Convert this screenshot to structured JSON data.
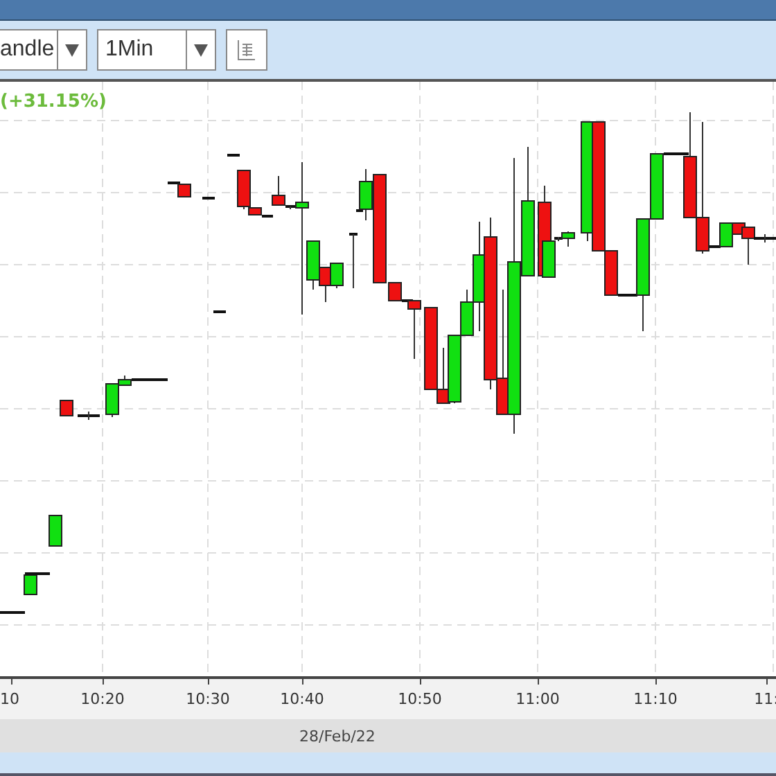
{
  "toolbar": {
    "chart_type": {
      "value": "andle"
    },
    "interval": {
      "value": "1Min"
    }
  },
  "chart": {
    "change_label": "(+31.15%)",
    "x_ticks": [
      "10",
      "10:20",
      "10:30",
      "10:40",
      "10:50",
      "11:00",
      "11:10",
      "11:"
    ],
    "date_label": "28/Feb/22"
  }
}
